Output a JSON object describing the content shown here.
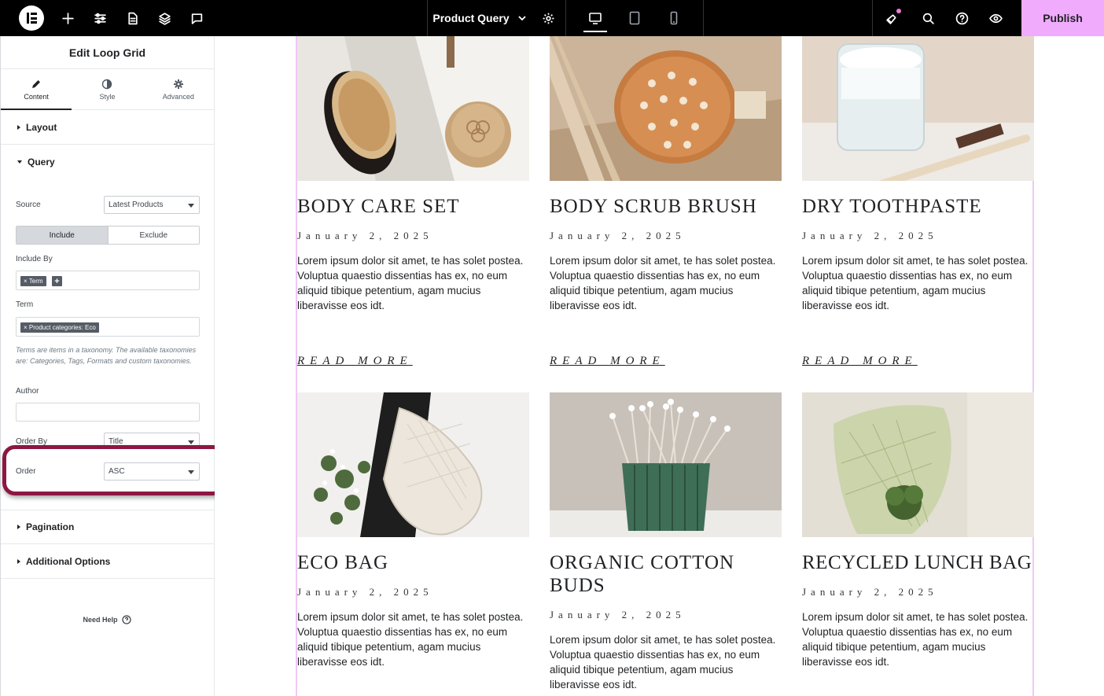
{
  "topbar": {
    "document_title": "Product Query",
    "publish_label": "Publish",
    "colors": {
      "bar": "#000000",
      "publish": "#f0abfc",
      "notification": "#e97cd8"
    }
  },
  "panel": {
    "title": "Edit Loop Grid",
    "tabs": [
      {
        "label": "Content",
        "icon": "pencil-icon",
        "active": true
      },
      {
        "label": "Style",
        "icon": "contrast-icon",
        "active": false
      },
      {
        "label": "Advanced",
        "icon": "gear-icon",
        "active": false
      }
    ],
    "sections": {
      "layout": "Layout",
      "query": "Query",
      "pagination": "Pagination",
      "additional": "Additional Options"
    },
    "query": {
      "source_label": "Source",
      "source_value": "Latest Products",
      "include_label": "Include",
      "exclude_label": "Exclude",
      "include_by_label": "Include By",
      "include_by_chip": "× Term",
      "term_label": "Term",
      "term_chip": "× Product categories: Eco",
      "help_text": "Terms are items in a taxonomy. The available taxonomies are: Categories, Tags, Formats and custom taxonomies.",
      "author_label": "Author",
      "order_by_label": "Order By",
      "order_by_value": "Title",
      "order_label": "Order",
      "order_value": "ASC"
    },
    "need_help": "Need Help",
    "highlight_color": "#8c1742"
  },
  "products": [
    {
      "title": "BODY CARE SET",
      "date": "January 2, 2025",
      "desc": "Lorem ipsum dolor sit amet, te has solet postea. Voluptua quaestio dissentias has ex, no eum aliquid tibique petentium, agam mucius liberavisse eos idt.",
      "more": "READ MORE"
    },
    {
      "title": "BODY SCRUB BRUSH",
      "date": "January 2, 2025",
      "desc": "Lorem ipsum dolor sit amet, te has solet postea. Voluptua quaestio dissentias has ex, no eum aliquid tibique petentium, agam mucius liberavisse eos idt.",
      "more": "READ MORE"
    },
    {
      "title": "DRY TOOTHPASTE",
      "date": "January 2, 2025",
      "desc": "Lorem ipsum dolor sit amet, te has solet postea. Voluptua quaestio dissentias has ex, no eum aliquid tibique petentium, agam mucius liberavisse eos idt.",
      "more": "READ MORE"
    },
    {
      "title": "ECO BAG",
      "date": "January 2, 2025",
      "desc": "Lorem ipsum dolor sit amet, te has solet postea. Voluptua quaestio dissentias has ex, no eum aliquid tibique petentium, agam mucius liberavisse eos idt."
    },
    {
      "title": "ORGANIC COTTON BUDS",
      "date": "January 2, 2025",
      "desc": "Lorem ipsum dolor sit amet, te has solet postea. Voluptua quaestio dissentias has ex, no eum aliquid tibique petentium, agam mucius liberavisse eos idt."
    },
    {
      "title": "RECYCLED LUNCH BAG",
      "date": "January 2, 2025",
      "desc": "Lorem ipsum dolor sit amet, te has solet postea. Voluptua quaestio dissentias has ex, no eum aliquid tibique petentium, agam mucius liberavisse eos idt."
    }
  ]
}
